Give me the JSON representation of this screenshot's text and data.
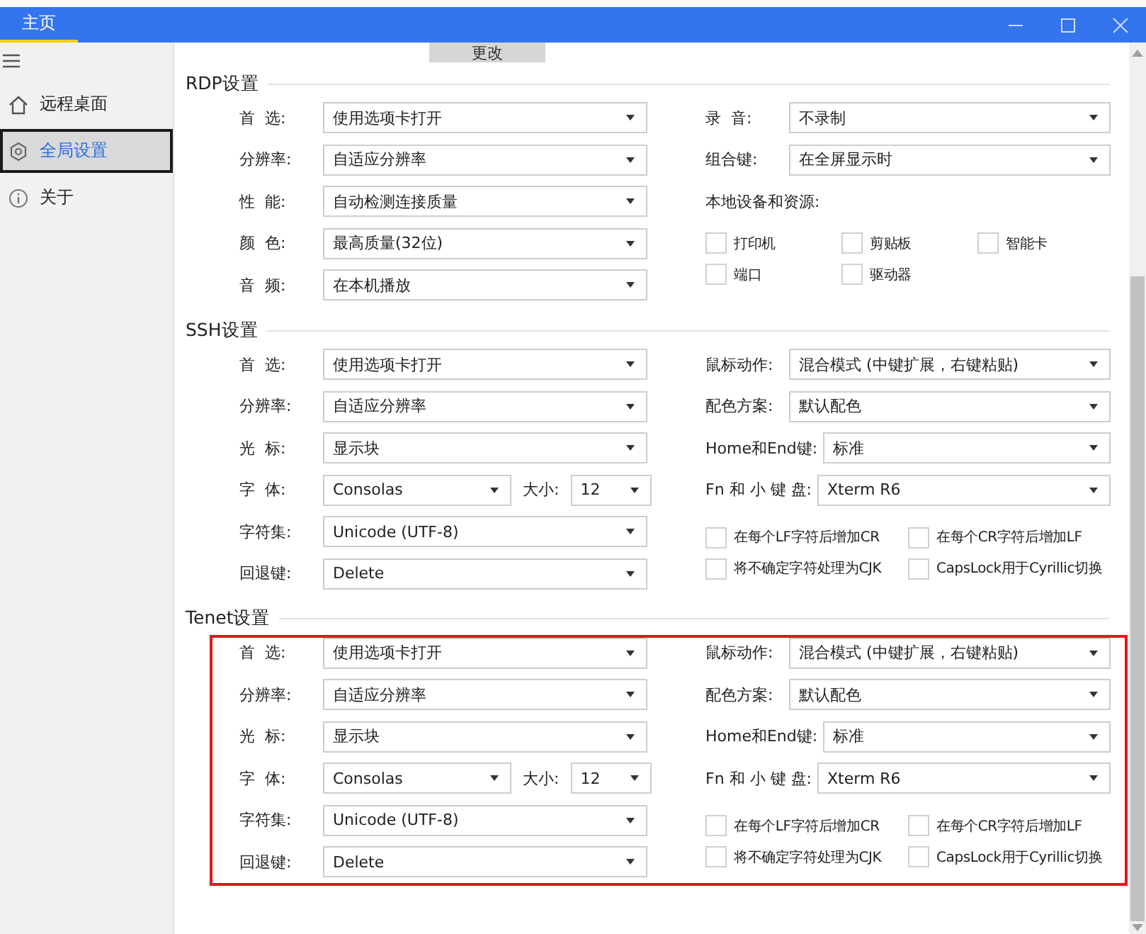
{
  "window": {
    "tab": "主页"
  },
  "sidebar": {
    "items": [
      {
        "label": "远程桌面",
        "kind": "home",
        "selected": false
      },
      {
        "label": "全局设置",
        "kind": "gear",
        "selected": true
      },
      {
        "label": "关于",
        "kind": "info",
        "selected": false
      }
    ]
  },
  "top_button": "更改",
  "sections": [
    {
      "title": "RDP设置",
      "highlighted": false,
      "left": [
        {
          "kind": "select",
          "label": "首  选:",
          "value": "使用选项卡打开"
        },
        {
          "kind": "select",
          "label": "分辨率:",
          "value": "自适应分辨率"
        },
        {
          "kind": "select",
          "label": "性  能:",
          "value": "自动检测连接质量"
        },
        {
          "kind": "select",
          "label": "颜  色:",
          "value": "最高质量(32位)"
        },
        {
          "kind": "select",
          "label": "音  频:",
          "value": "在本机播放"
        }
      ],
      "right": [
        {
          "kind": "select",
          "label": "录  音:",
          "value": "不录制"
        },
        {
          "kind": "select",
          "label": "组合键:",
          "value": "在全屏显示时"
        },
        {
          "kind": "heading",
          "label": "本地设备和资源:"
        },
        {
          "kind": "devices",
          "items": [
            {
              "label": "打印机",
              "checked": false
            },
            {
              "label": "剪贴板",
              "checked": false
            },
            {
              "label": "智能卡",
              "checked": false
            },
            {
              "label": "端口",
              "checked": false
            },
            {
              "label": "驱动器",
              "checked": false
            }
          ]
        }
      ]
    },
    {
      "title": "SSH设置",
      "highlighted": false,
      "left": [
        {
          "kind": "select",
          "label": "首  选:",
          "value": "使用选项卡打开"
        },
        {
          "kind": "select",
          "label": "分辨率:",
          "value": "自适应分辨率"
        },
        {
          "kind": "select",
          "label": "光  标:",
          "value": "显示块"
        },
        {
          "kind": "font",
          "label": "字  体:",
          "value": "Consolas",
          "size_label": "大小:",
          "size_value": "12"
        },
        {
          "kind": "select",
          "label": "字符集:",
          "value": "Unicode (UTF-8)"
        },
        {
          "kind": "select",
          "label": "回退键:",
          "value": "Delete"
        }
      ],
      "right": [
        {
          "kind": "select",
          "label": "鼠标动作:",
          "value": "混合模式 (中键扩展，右键粘贴)"
        },
        {
          "kind": "select",
          "label": "配色方案:",
          "value": "默认配色"
        },
        {
          "kind": "select",
          "label": "Home和End键:",
          "value": "标准"
        },
        {
          "kind": "select",
          "label": "Fn 和 小 键 盘:",
          "value": "Xterm R6"
        },
        {
          "kind": "options",
          "items": [
            {
              "label": "在每个LF字符后增加CR",
              "checked": false
            },
            {
              "label": "在每个CR字符后增加LF",
              "checked": false
            },
            {
              "label": "将不确定字符处理为CJK",
              "checked": false
            },
            {
              "label": "CapsLock用于Cyrillic切换",
              "checked": false
            }
          ]
        }
      ]
    },
    {
      "title": "Tenet设置",
      "highlighted": true,
      "left": [
        {
          "kind": "select",
          "label": "首  选:",
          "value": "使用选项卡打开"
        },
        {
          "kind": "select",
          "label": "分辨率:",
          "value": "自适应分辨率"
        },
        {
          "kind": "select",
          "label": "光  标:",
          "value": "显示块"
        },
        {
          "kind": "font",
          "label": "字  体:",
          "value": "Consolas",
          "size_label": "大小:",
          "size_value": "12"
        },
        {
          "kind": "select",
          "label": "字符集:",
          "value": "Unicode (UTF-8)"
        },
        {
          "kind": "select",
          "label": "回退键:",
          "value": "Delete"
        }
      ],
      "right": [
        {
          "kind": "select",
          "label": "鼠标动作:",
          "value": "混合模式 (中键扩展，右键粘贴)"
        },
        {
          "kind": "select",
          "label": "配色方案:",
          "value": "默认配色"
        },
        {
          "kind": "select",
          "label": "Home和End键:",
          "value": "标准"
        },
        {
          "kind": "select",
          "label": "Fn 和 小 键 盘:",
          "value": "Xterm R6"
        },
        {
          "kind": "options",
          "items": [
            {
              "label": "在每个LF字符后增加CR",
              "checked": false
            },
            {
              "label": "在每个CR字符后增加LF",
              "checked": false
            },
            {
              "label": "将不确定字符处理为CJK",
              "checked": false
            },
            {
              "label": "CapsLock用于Cyrillic切换",
              "checked": false
            }
          ]
        }
      ]
    }
  ]
}
